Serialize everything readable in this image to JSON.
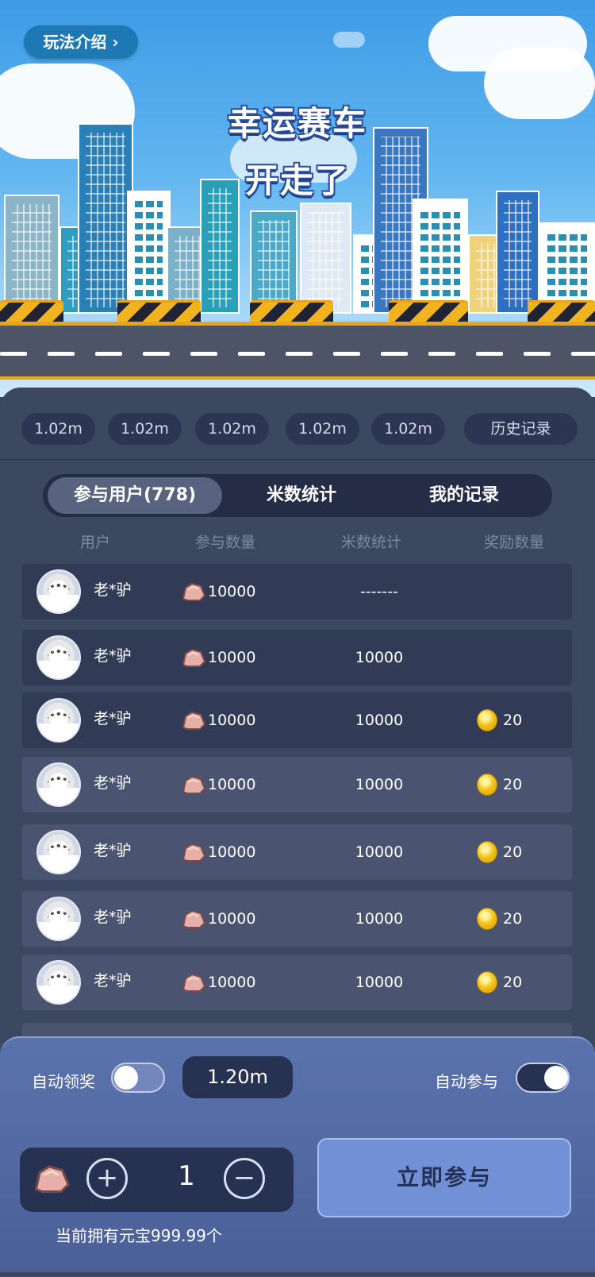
{
  "header": {
    "howto_label": "玩法介绍",
    "howto_icon": "chevron-right-icon",
    "title_line1": "幸运赛车",
    "title_line2": "开走了"
  },
  "history_pills": [
    "1.02m",
    "1.02m",
    "1.02m",
    "1.02m",
    "1.02m"
  ],
  "history_button": "历史记录",
  "tabs": [
    {
      "label": "参与用户(778)",
      "active": true
    },
    {
      "label": "米数统计",
      "active": false
    },
    {
      "label": "我的记录",
      "active": false
    }
  ],
  "table": {
    "headers": [
      "用户",
      "参与数量",
      "米数统计",
      "奖励数量"
    ],
    "rows": [
      {
        "user": "老*驴",
        "amount": "10000",
        "meters": "-------",
        "reward": ""
      },
      {
        "user": "老*驴",
        "amount": "10000",
        "meters": "10000",
        "reward": ""
      },
      {
        "user": "老*驴",
        "amount": "10000",
        "meters": "10000",
        "reward": "20"
      },
      {
        "user": "老*驴",
        "amount": "10000",
        "meters": "10000",
        "reward": "20"
      },
      {
        "user": "老*驴",
        "amount": "10000",
        "meters": "10000",
        "reward": "20"
      },
      {
        "user": "老*驴",
        "amount": "10000",
        "meters": "10000",
        "reward": "20"
      },
      {
        "user": "老*驴",
        "amount": "10000",
        "meters": "10000",
        "reward": "20"
      }
    ]
  },
  "bottom": {
    "auto_claim_label": "自动领奖",
    "auto_claim_on": false,
    "meter_value": "1.20m",
    "auto_join_label": "自动参与",
    "auto_join_on": true,
    "plus_symbol": "+",
    "minus_symbol": "−",
    "count": "1",
    "join_button": "立即参与",
    "balance_text": "当前拥有元宝999.99个"
  },
  "colors": {
    "panel": "#3c4760",
    "tab_bg": "#252d46",
    "accent_button": "#7290d5",
    "road_stripe": "#e9a516"
  }
}
